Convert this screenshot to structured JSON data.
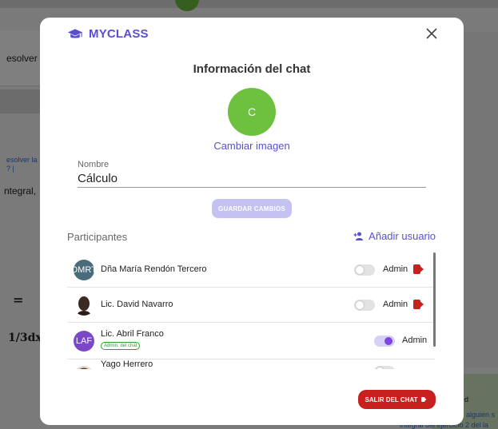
{
  "background": {
    "left_text_1": "esolver",
    "left_link_1": "esolver la",
    "left_link_2": "? |",
    "left_text_2": "ntegral,",
    "math_1": "=",
    "math_2": "1/3dx",
    "right_text_1": "d",
    "right_link_1": "alguien s",
    "right_link_2": "integral del ejercicio 2 del la"
  },
  "modal": {
    "brand": "MYCLASS",
    "title": "Información del chat",
    "avatar_initial": "C",
    "change_image": "Cambiar imagen",
    "name_label": "Nombre",
    "name_value": "Cálculo",
    "save_button": "GUARDAR CAMBIOS",
    "participants_title": "Participantes",
    "add_user": "Añadir usuario",
    "admin_label": "Admin",
    "leave_button": "SALIR DEL CHAT",
    "participants": [
      {
        "name": "Dña María Rendón Tercero",
        "initials": "DMRT",
        "avatar_color": "#4a6b7a",
        "admin": false
      },
      {
        "name": "Lic. David Navarro",
        "initials": "",
        "avatar_color": "#3b2a22",
        "admin": false
      },
      {
        "name": "Lic. Abril Franco",
        "initials": "LAF",
        "avatar_color": "#7b47c9",
        "admin": true,
        "badge": "Admin. del chat"
      },
      {
        "name": "Yago Herrero",
        "initials": "",
        "avatar_color": "#c9a58a",
        "admin": false
      }
    ]
  },
  "colors": {
    "brand": "#5a4fcf",
    "avatar_green": "#6dc13f",
    "danger": "#c8201e",
    "toggle_on": "#7b47e0"
  }
}
